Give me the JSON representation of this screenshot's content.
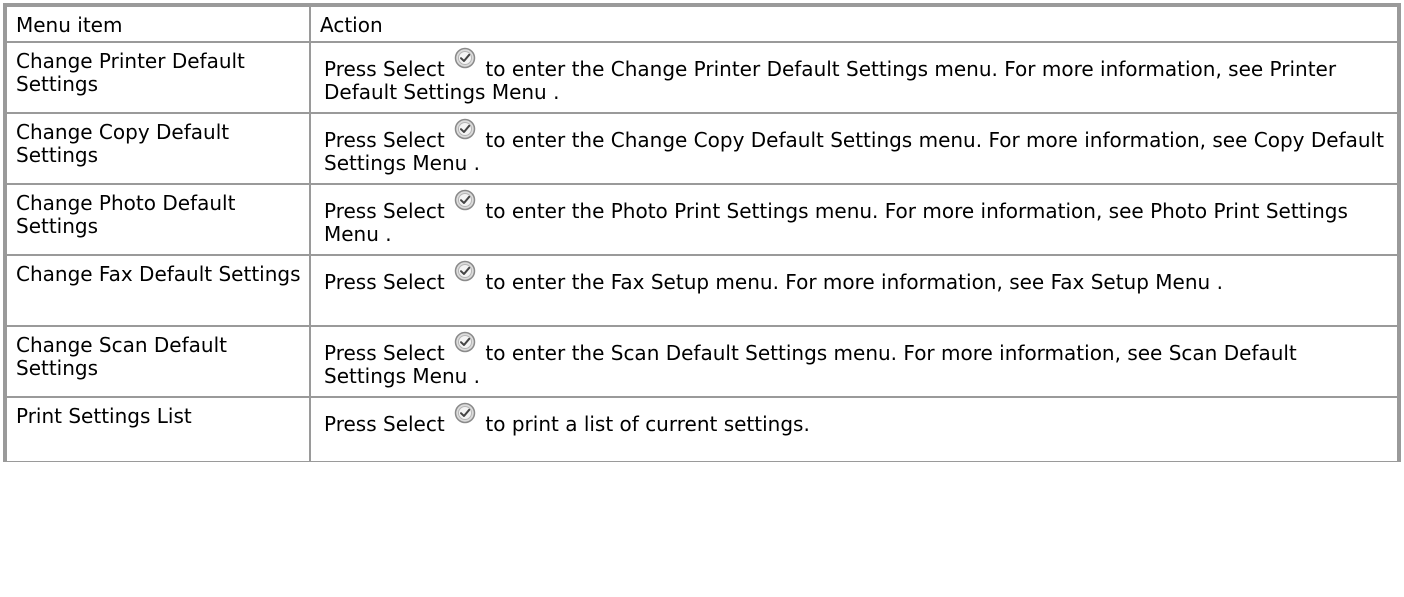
{
  "table": {
    "header": {
      "menu_item": "Menu item",
      "action": "Action"
    },
    "rows": [
      {
        "item": "Change Printer Default Settings",
        "before_icon": "Press Select",
        "after_icon": "to enter the Change Printer Default Settings menu. For more information, see",
        "link": "Printer Default Settings Menu",
        "tail": "."
      },
      {
        "item": "Change Copy Default Settings",
        "before_icon": "Press Select",
        "after_icon": "to enter the Change Copy Default Settings menu. For more information, see",
        "link": "Copy Default Settings Menu",
        "tail": "."
      },
      {
        "item": "Change Photo Default Settings",
        "before_icon": "Press Select",
        "after_icon": "to enter the Photo Print Settings menu. For more information, see",
        "link": "Photo Print Settings Menu",
        "tail": "."
      },
      {
        "item": "Change Fax Default Settings",
        "before_icon": "Press Select",
        "after_icon": "to enter the Fax Setup menu. For more information, see",
        "link": "Fax Setup Menu",
        "tail": "."
      },
      {
        "item": "Change Scan Default Settings",
        "before_icon": "Press Select",
        "after_icon": "to enter the Scan Default Settings menu. For more information, see",
        "link": "Scan Default Settings Menu",
        "tail": "."
      },
      {
        "item": "Print Settings List",
        "before_icon": "Press Select",
        "after_icon": "to print a list of current settings.",
        "link": "",
        "tail": ""
      }
    ],
    "icon": "select-check-icon",
    "border_color": "#9a9a9a"
  }
}
